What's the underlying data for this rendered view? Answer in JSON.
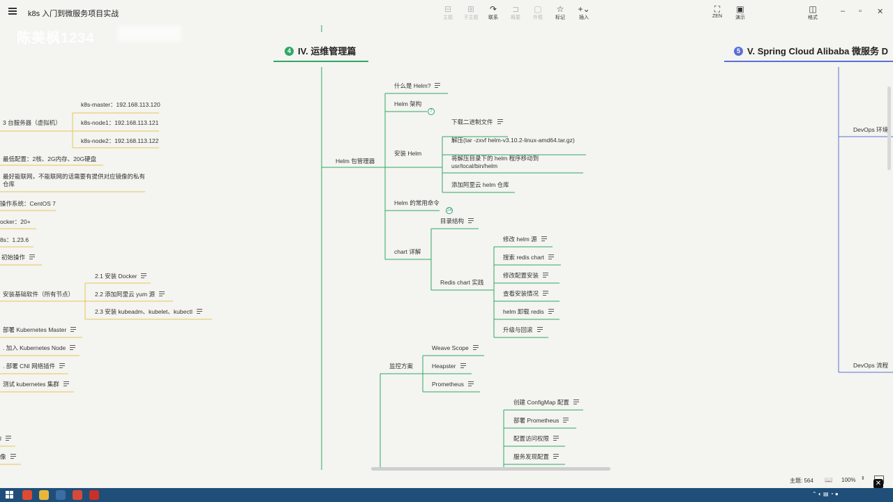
{
  "app": {
    "title": "k8s 入门到微服务项目实战"
  },
  "watermark": "陈美枫1234",
  "toolbar": {
    "items": [
      {
        "label": "主题",
        "icon": "topic-icon",
        "enabled": false
      },
      {
        "label": "子主题",
        "icon": "subtopic-icon",
        "enabled": false
      },
      {
        "label": "联系",
        "icon": "relation-icon",
        "enabled": true
      },
      {
        "label": "概要",
        "icon": "summary-icon",
        "enabled": false
      },
      {
        "label": "外框",
        "icon": "boundary-icon",
        "enabled": false
      },
      {
        "label": "标记",
        "icon": "star-icon",
        "enabled": true
      },
      {
        "label": "插入",
        "icon": "plus-icon",
        "enabled": true
      }
    ],
    "right": [
      {
        "label": "ZEN",
        "icon": "zen-icon"
      },
      {
        "label": "演示",
        "icon": "present-icon"
      },
      {
        "label": "格式",
        "icon": "format-icon"
      }
    ]
  },
  "sections": {
    "ops": {
      "number": "4",
      "title": "IV. 运维管理篇",
      "color": "#2ea866"
    },
    "cloud": {
      "number": "5",
      "title": "V. Spring Cloud Alibaba 微服务 D",
      "color": "#5a6fd8"
    }
  },
  "left_nodes": {
    "servers": "3 台服务器（虚拟机）",
    "master": "k8s-master：192.168.113.120",
    "node1": "k8s-node1：192.168.113.121",
    "node2": "k8s-node2：192.168.113.122",
    "min_config": "最低配置：2核、2G内存、20G硬盘",
    "network": "最好能联网，不能联网的话需要有提供对应镜像的私有仓库",
    "os": "操作系统：CentOS 7",
    "docker": "ocker：20+",
    "k8s": "8s：1.23.6",
    "init": "初始操作",
    "install_base": "安装基础软件（所有节点）",
    "install_docker": "2.1 安装 Docker",
    "add_yum": "2.2 添加阿里云 yum 源",
    "install_kube": "2.3 安装 kubeadm、kubelet、kubectl",
    "deploy_master": "部署 Kubernetes Master",
    "join_node": ". 加入 Kubernetes Node",
    "deploy_cni": ". 部署 CNI 网络插件",
    "test_cluster": "测试 kubernetes 集群",
    "cut1": "l",
    "cut2": "像"
  },
  "helm": {
    "root": "Helm 包管理器",
    "what": "什么是 Helm?",
    "arch": "Helm 架构",
    "arch_count": "7",
    "install": "安装 Helm",
    "download": "下载二进制文件",
    "extract": "解压(tar -zxvf helm-v3.10.2-linux-amd64.tar.gz)",
    "move": "将解压目录下的 helm 程序移动到 usr/local/bin/helm",
    "add_repo": "添加阿里云 helm 仓库",
    "commands": "Helm 的常用命令",
    "commands_count": "24",
    "chart": "chart 详解",
    "dir": "目录结构",
    "redis": "Redis chart 实践",
    "redis_items": [
      "修改 helm 源",
      "搜索 redis chart",
      "修改配置安装",
      "查看安装情况",
      "helm 卸载 redis",
      "升级与回滚"
    ]
  },
  "monitor": {
    "root": "监控方案",
    "items": [
      "Weave Scope",
      "Heapster",
      "Prometheus"
    ],
    "prom_items": [
      "创建 ConfigMap 配置",
      "部署 Prometheus",
      "配置访问权限",
      "服务发现配置"
    ]
  },
  "right_nodes": {
    "devops_env": "DevOps 环境",
    "devops_flow": "DevOps 流程"
  },
  "status": {
    "topics": "主题: 564",
    "zoom": "100%"
  }
}
